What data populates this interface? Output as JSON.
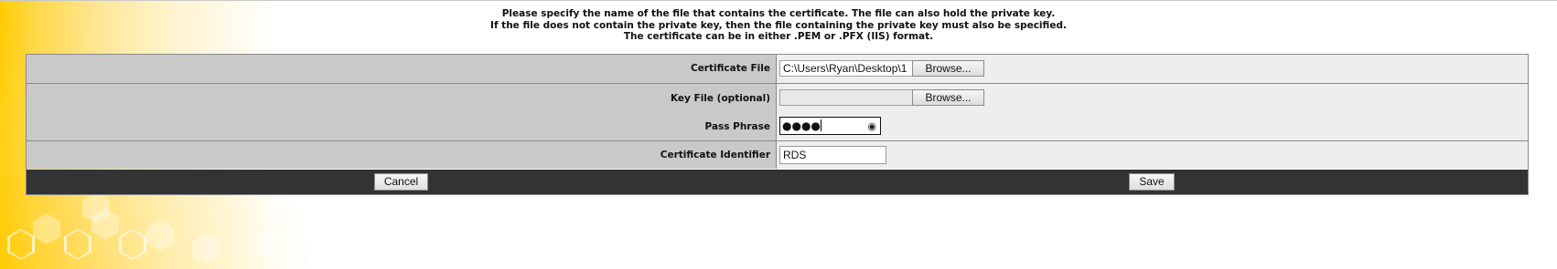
{
  "instructions": {
    "line1": "Please specify the name of the file that contains the certificate. The file can also hold the private key.",
    "line2": "If the file does not contain the private key, then the file containing the private key must also be specified.",
    "line3": "The certificate can be in either .PEM or .PFX (IIS) format."
  },
  "form": {
    "certificate_file": {
      "label": "Certificate File",
      "value": "C:\\Users\\Ryan\\Desktop\\1",
      "browse_label": "Browse..."
    },
    "key_file": {
      "label": "Key File (optional)",
      "value": "",
      "browse_label": "Browse..."
    },
    "pass_phrase": {
      "label": "Pass Phrase",
      "masked_value": "●●●●"
    },
    "certificate_identifier": {
      "label": "Certificate Identifier",
      "value": "RDS"
    }
  },
  "buttons": {
    "cancel_label": "Cancel",
    "save_label": "Save"
  },
  "icons": {
    "reveal_password": "eye-icon"
  },
  "colors": {
    "label_bg": "#c9c9c9",
    "value_bg": "#eeeeee",
    "footer_bar": "#333333",
    "accent_yellow": "#ffcc00"
  }
}
